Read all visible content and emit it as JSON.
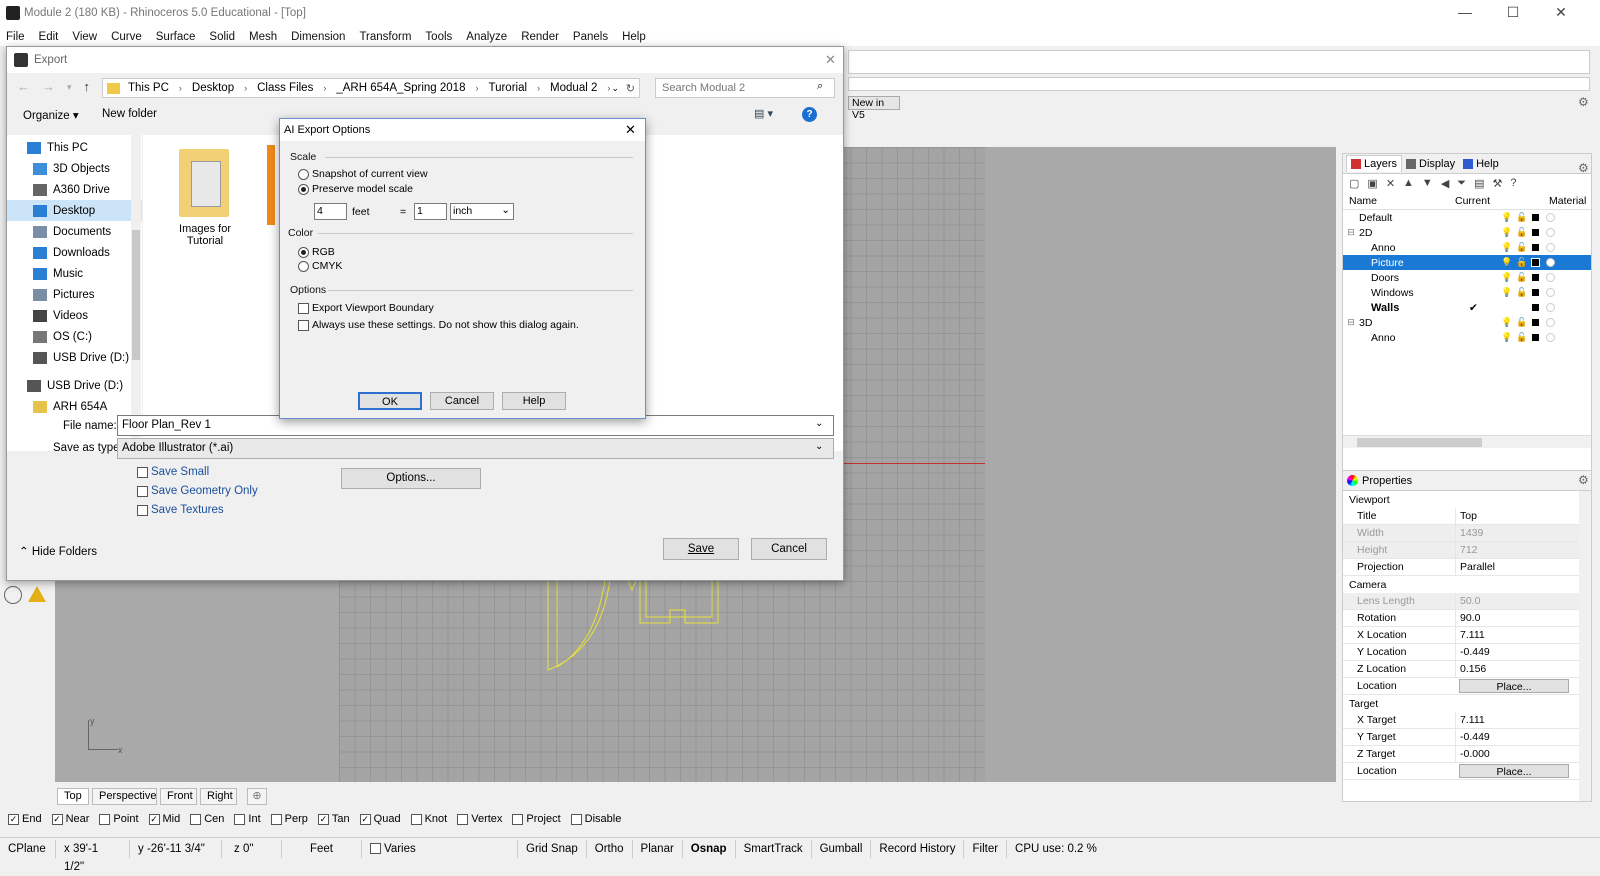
{
  "app": {
    "title": "Module 2 (180 KB) - Rhinoceros 5.0 Educational - [Top]",
    "min": "—",
    "max": "☐",
    "close": "✕"
  },
  "menu": [
    "File",
    "Edit",
    "View",
    "Curve",
    "Surface",
    "Solid",
    "Mesh",
    "Dimension",
    "Transform",
    "Tools",
    "Analyze",
    "Render",
    "Panels",
    "Help"
  ],
  "toolbar_tab": "New in V5",
  "viewport_tabs": [
    "Top",
    "Perspective",
    "Front",
    "Right"
  ],
  "osnaps": [
    {
      "label": "End",
      "on": true
    },
    {
      "label": "Near",
      "on": true
    },
    {
      "label": "Point",
      "on": false
    },
    {
      "label": "Mid",
      "on": true
    },
    {
      "label": "Cen",
      "on": false
    },
    {
      "label": "Int",
      "on": false
    },
    {
      "label": "Perp",
      "on": false
    },
    {
      "label": "Tan",
      "on": true
    },
    {
      "label": "Quad",
      "on": true
    },
    {
      "label": "Knot",
      "on": false
    },
    {
      "label": "Vertex",
      "on": false
    },
    {
      "label": "Project",
      "on": false
    },
    {
      "label": "Disable",
      "on": false
    }
  ],
  "status": {
    "cplane": "CPlane",
    "x": "x 39'-1 1/2\"",
    "y": "y -26'-11 3/4\"",
    "z": "z 0\"",
    "units": "Feet",
    "layer": "Varies",
    "items": [
      "Grid Snap",
      "Ortho",
      "Planar",
      "Osnap",
      "SmartTrack",
      "Gumball",
      "Record History",
      "Filter"
    ],
    "cpu": "CPU use: 0.2 %"
  },
  "layers_panel": {
    "tabs": [
      "Layers",
      "Display",
      "Help"
    ],
    "cols": [
      "Name",
      "Current",
      "Material"
    ],
    "rows": [
      {
        "name": "Default",
        "indent": 0,
        "expand": ""
      },
      {
        "name": "2D",
        "indent": 0,
        "expand": "⊟"
      },
      {
        "name": "Anno",
        "indent": 1,
        "expand": ""
      },
      {
        "name": "Picture",
        "indent": 1,
        "expand": "",
        "sel": true
      },
      {
        "name": "Doors",
        "indent": 1,
        "expand": ""
      },
      {
        "name": "Windows",
        "indent": 1,
        "expand": ""
      },
      {
        "name": "Walls",
        "indent": 1,
        "expand": "",
        "current": "✔",
        "bold": true
      },
      {
        "name": "3D",
        "indent": 0,
        "expand": "⊟"
      },
      {
        "name": "Anno",
        "indent": 1,
        "expand": ""
      }
    ]
  },
  "properties": {
    "title": "Properties",
    "viewport_h": "Viewport",
    "viewport": [
      {
        "k": "Title",
        "v": "Top"
      },
      {
        "k": "Width",
        "v": "1439",
        "dis": true
      },
      {
        "k": "Height",
        "v": "712",
        "dis": true
      },
      {
        "k": "Projection",
        "v": "Parallel"
      }
    ],
    "camera_h": "Camera",
    "camera": [
      {
        "k": "Lens Length",
        "v": "50.0",
        "dis": true
      },
      {
        "k": "Rotation",
        "v": "90.0"
      },
      {
        "k": "X Location",
        "v": "7.111"
      },
      {
        "k": "Y Location",
        "v": "-0.449"
      },
      {
        "k": "Z Location",
        "v": "0.156"
      }
    ],
    "loc_k": "Location",
    "place": "Place...",
    "target_h": "Target",
    "target": [
      {
        "k": "X Target",
        "v": "7.111"
      },
      {
        "k": "Y Target",
        "v": "-0.449"
      },
      {
        "k": "Z Target",
        "v": "-0.000"
      }
    ]
  },
  "export": {
    "title": "Export",
    "breadcrumb": [
      "This PC",
      "Desktop",
      "Class Files",
      "_ARH 654A_Spring 2018",
      "Turorial",
      "Modual 2"
    ],
    "search": "Search Modual 2",
    "organize": "Organize ▾",
    "new_folder": "New folder",
    "tree": [
      {
        "label": "This PC",
        "color": "#2a7fd4",
        "lvl": 0
      },
      {
        "label": "3D Objects",
        "color": "#3c8fd8",
        "lvl": 1
      },
      {
        "label": "A360 Drive",
        "color": "#666",
        "lvl": 1
      },
      {
        "label": "Desktop",
        "color": "#2a7fd4",
        "lvl": 1,
        "sel": true
      },
      {
        "label": "Documents",
        "color": "#7a8ea6",
        "lvl": 1
      },
      {
        "label": "Downloads",
        "color": "#2a7fd4",
        "lvl": 1
      },
      {
        "label": "Music",
        "color": "#2a7fd4",
        "lvl": 1
      },
      {
        "label": "Pictures",
        "color": "#7a8ea6",
        "lvl": 1
      },
      {
        "label": "Videos",
        "color": "#444",
        "lvl": 1
      },
      {
        "label": "OS (C:)",
        "color": "#777",
        "lvl": 1
      },
      {
        "label": "USB Drive (D:)",
        "color": "#555",
        "lvl": 1
      },
      {
        "label": "USB Drive (D:)",
        "color": "#555",
        "lvl": 0
      },
      {
        "label": "ARH 654A",
        "color": "#e6c34a",
        "lvl": 1
      }
    ],
    "folder_label": "Images for Tutorial",
    "filename_label": "File name:",
    "filename": "Floor Plan_Rev 1",
    "type_label": "Save as type:",
    "type": "Adobe Illustrator (*.ai)",
    "checks": [
      "Save Small",
      "Save Geometry Only",
      "Save Textures"
    ],
    "options": "Options...",
    "hide": "Hide Folders",
    "save": "Save",
    "cancel": "Cancel"
  },
  "ai": {
    "title": "AI Export Options",
    "scale_h": "Scale",
    "snap": "Snapshot of current view",
    "preserve": "Preserve model scale",
    "model_val": "4",
    "model_unit": "feet",
    "eq": "=",
    "paper_val": "1",
    "paper_unit": "inch",
    "color_h": "Color",
    "rgb": "RGB",
    "cmyk": "CMYK",
    "opt_h": "Options",
    "opt1": "Export Viewport Boundary",
    "opt2": "Always use these settings. Do not show this dialog again.",
    "ok": "OK",
    "cancel": "Cancel",
    "help": "Help"
  }
}
